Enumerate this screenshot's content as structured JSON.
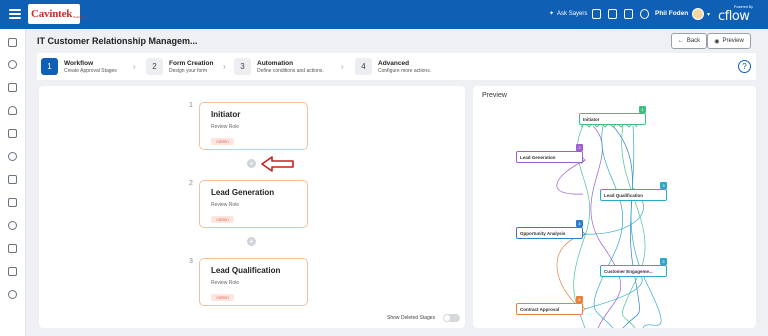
{
  "topbar": {
    "brand": "Cavintek",
    "brand_sub": "Solutions",
    "ask_label": "Ask Sayers",
    "user_name": "Phil Foden",
    "powered_by": "Powered By",
    "cflow": "cflow",
    "icons": [
      "sparkle-icon",
      "document-icon",
      "grid-icon",
      "calendar-icon",
      "help-icon",
      "avatar",
      "chevron-down-icon"
    ]
  },
  "sidebar": {
    "icons": [
      "home-icon",
      "share-icon",
      "inbox-icon",
      "lightbulb-icon",
      "chart-icon",
      "users-icon",
      "flow-icon",
      "report-icon",
      "history-icon",
      "tools-icon",
      "edit-icon",
      "settings-icon"
    ]
  },
  "header": {
    "title": "IT Customer Relationship Managem...",
    "back_label": "Back",
    "preview_label": "Preview"
  },
  "stepper": {
    "steps": [
      {
        "num": "1",
        "title": "Workflow",
        "sub": "Create Approval Stages",
        "active": true
      },
      {
        "num": "2",
        "title": "Form Creation",
        "sub": "Design your form",
        "active": false
      },
      {
        "num": "3",
        "title": "Automation",
        "sub": "Define conditions and actions.",
        "active": false
      },
      {
        "num": "4",
        "title": "Advanced",
        "sub": "Configure more actions.",
        "active": false
      }
    ]
  },
  "workflow": {
    "stages": [
      {
        "num": "1",
        "name": "Initiator",
        "role": "Review Role",
        "badge": "Admin"
      },
      {
        "num": "2",
        "name": "Lead Generation",
        "role": "Review Role",
        "badge": "Admin"
      },
      {
        "num": "3",
        "name": "Lead Qualification",
        "role": "Review Role",
        "badge": "Admin"
      }
    ],
    "add_symbol": "+",
    "show_deleted_label": "Show Deleted Stages",
    "show_deleted_on": false,
    "arrow_color": "#c8201f"
  },
  "preview": {
    "title": "Preview",
    "nodes": [
      {
        "badge": "1",
        "label": "Initiator",
        "color": "#3fbf7f"
      },
      {
        "badge": "2",
        "label": "Lead Generation",
        "color": "#9b5fd0"
      },
      {
        "badge": "3",
        "label": "Lead Qualification",
        "color": "#2fa8c8"
      },
      {
        "badge": "4",
        "label": "Opportunity Analysis",
        "color": "#2f7fd0"
      },
      {
        "badge": "5",
        "label": "Customer Engageme...",
        "color": "#2fa8c8"
      },
      {
        "badge": "6",
        "label": "Contract Approval",
        "color": "#e8813a"
      }
    ]
  },
  "colors": {
    "brand_blue": "#0f5fb5",
    "stage_border": "#f0c19a",
    "badge_text": "#e26a5a"
  }
}
